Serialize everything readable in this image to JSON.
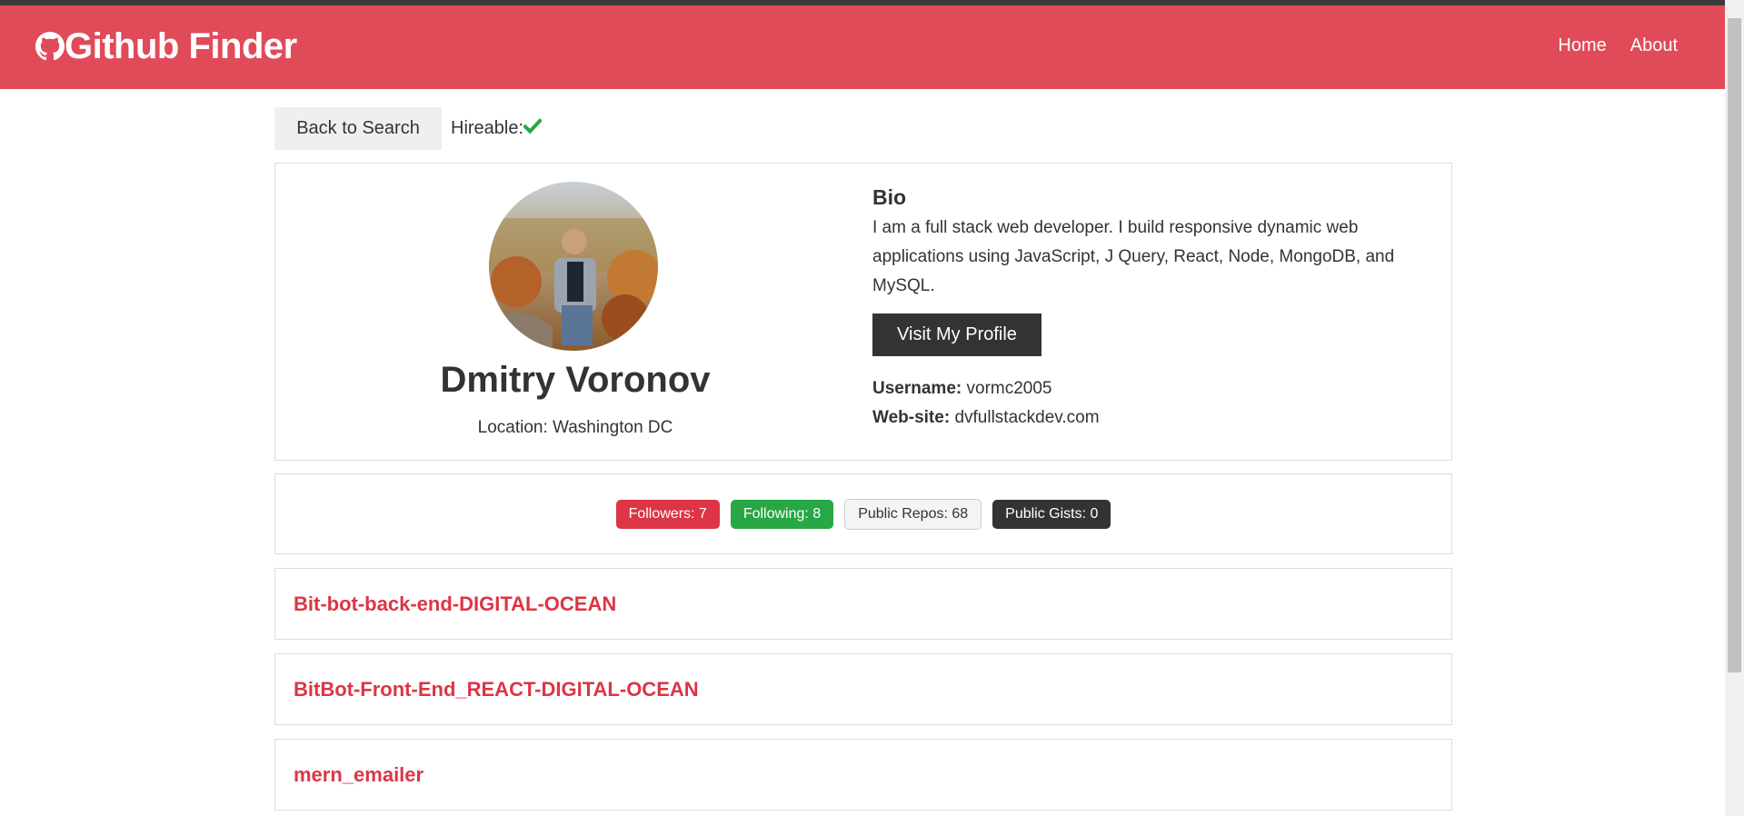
{
  "header": {
    "brand": "Github Finder",
    "nav": [
      {
        "label": "Home"
      },
      {
        "label": "About"
      }
    ]
  },
  "toolbar": {
    "back_label": "Back to Search",
    "hireable_label": "Hireable:"
  },
  "profile": {
    "name": "Dmitry Voronov",
    "location": "Location: Washington DC",
    "bio_heading": "Bio",
    "bio": "I am a full stack web developer. I build responsive dynamic web applications using JavaScript, J Query, React, Node, MongoDB, and MySQL.",
    "visit_label": "Visit My Profile",
    "username_label": "Username:",
    "username": "vormc2005",
    "website_label": "Web-site:",
    "website": "dvfullstackdev.com"
  },
  "stats": {
    "followers": "Followers: 7",
    "following": "Following: 8",
    "repos": "Public Repos: 68",
    "gists": "Public Gists: 0"
  },
  "repos": [
    {
      "name": "Bit-bot-back-end-DIGITAL-OCEAN"
    },
    {
      "name": "BitBot-Front-End_REACT-DIGITAL-OCEAN"
    },
    {
      "name": "mern_emailer"
    }
  ],
  "colors": {
    "navbar": "#e04b5a",
    "badge_red": "#dc3545",
    "badge_green": "#28a745",
    "badge_dark": "#333333",
    "check_green": "#28a745"
  },
  "icons": {
    "brand": "github-icon",
    "hireable": "check-icon"
  }
}
